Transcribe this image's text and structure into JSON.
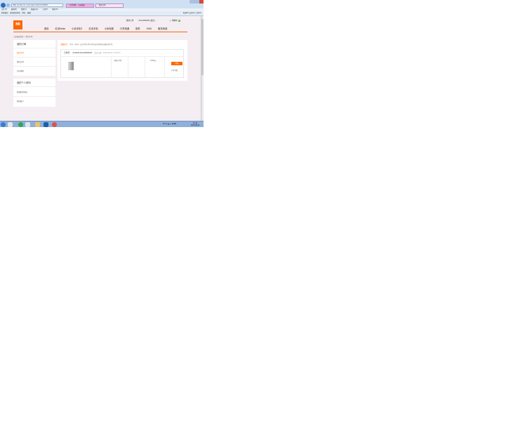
{
  "browser": {
    "address": "http://order.mi.com/user/order/1141803...",
    "tabs": [
      "订单详情 - 小米商城",
      "我的订单"
    ],
    "menu": [
      "文件(F)",
      "编辑(E)",
      "查看(V)",
      "收藏夹(A)",
      "工具(T)",
      "帮助(H)"
    ],
    "favorites": [
      "网站建议",
      "建议网站列表",
      "网站",
      "截图"
    ],
    "tools": [
      "页面(P)",
      "安全(S)",
      "工具(O)"
    ]
  },
  "site": {
    "logo": "MI",
    "top_links": [
      "我的订单",
      "4104086691(退出)"
    ],
    "cart_label": "购物车",
    "cart_count": "0",
    "nav": [
      "首页",
      "红米Note",
      "小米手机3",
      "红米手机",
      "小米电视",
      "行货电源",
      "配件",
      "MIUI",
      "服务商城"
    ],
    "breadcrumb": "小米商城首页 > 我的订单"
  },
  "sidebar": {
    "group1_title": "我的订单",
    "group1_items": [
      "我的订单",
      "我的订单",
      "评价晒单"
    ],
    "group2_title": "我的个人资料",
    "group2_items": [
      "管理收货地址",
      "我的账户"
    ]
  },
  "main": {
    "notice_link": "温馨提示：",
    "notice_text": "不对（分享）如订单在48小时内未付款将自动取消订单。",
    "order_label": "订单号：",
    "order_no": "1140812220006097",
    "order_date": "成交日期：2014-08-12 12:09:31",
    "qty": "购买×1件",
    "price": "4799元",
    "pay_button": "付款",
    "detail_link": "订单详情"
  },
  "taskbar": {
    "tray_text": "CH 中 ▲ ✔ ◀ ⌨",
    "time": "12:11",
    "date": "2014/8/12"
  },
  "colors": {
    "accent": "#ff6700",
    "page_bg": "#f4eef3"
  }
}
